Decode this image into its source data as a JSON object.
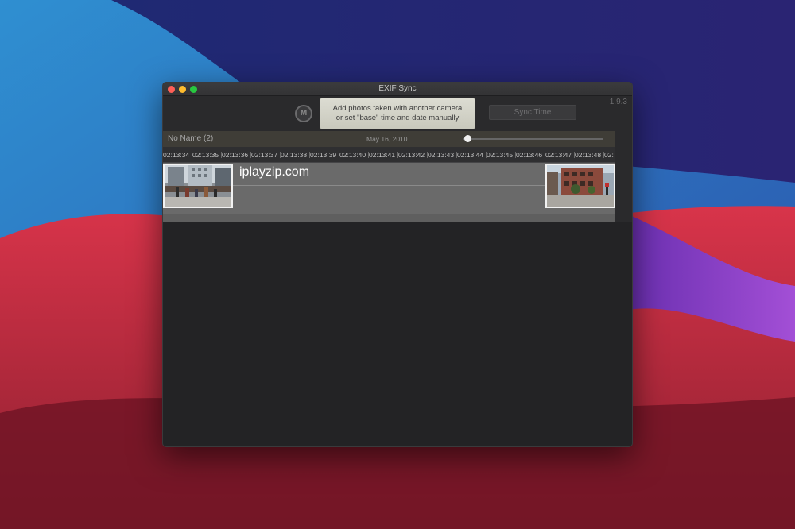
{
  "window": {
    "title": "EXIF Sync",
    "version": "1.9.3"
  },
  "toolbar": {
    "manual_button_label": "M",
    "hint_line1": "Add photos taken with another camera",
    "hint_line2": "or set \"base\" time and date manually",
    "sync_button_label": "Sync Time"
  },
  "track": {
    "name": "No Name (2)",
    "date": "May 16, 2010",
    "zoom_fraction": 0.03
  },
  "ruler_ticks": [
    "02:13:34",
    "02:13:35",
    "02:13:36",
    "02:13:37",
    "02:13:38",
    "02:13:39",
    "02:13:40",
    "02:13:41",
    "02:13:42",
    "02:13:43",
    "02:13:44",
    "02:13:45",
    "02:13:46",
    "02:13:47",
    "02:13:48",
    "02:"
  ],
  "photos": [
    {
      "name": "photo-street-scene"
    },
    {
      "name": "photo-building-corner"
    }
  ],
  "watermark": "iplayzip.com",
  "colors": {
    "close": "#fe5f57",
    "minimize": "#febc2e",
    "maximize": "#28c840"
  }
}
